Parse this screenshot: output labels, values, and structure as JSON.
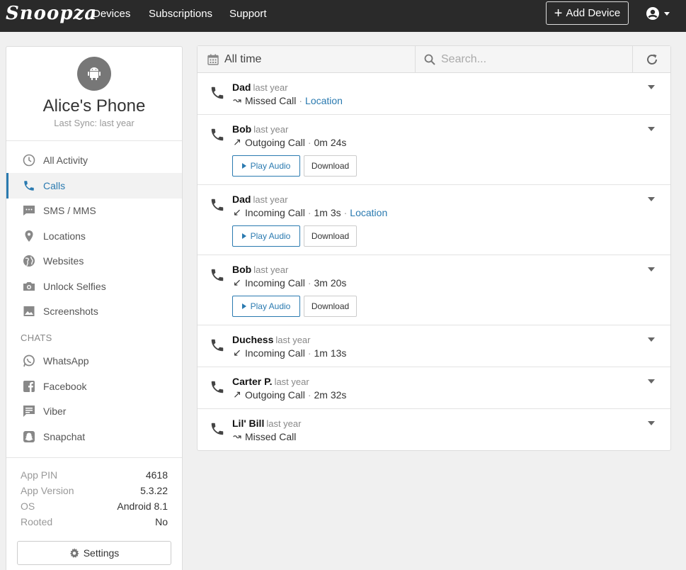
{
  "nav": {
    "logo": "Snoopza",
    "links": [
      "Devices",
      "Subscriptions",
      "Support"
    ],
    "add_device": "Add Device"
  },
  "device": {
    "name": "Alice's Phone",
    "last_sync": "Last Sync: last year"
  },
  "sidebar": {
    "items": [
      {
        "label": "All Activity",
        "icon": "clock-icon"
      },
      {
        "label": "Calls",
        "icon": "phone-icon",
        "active": true
      },
      {
        "label": "SMS / MMS",
        "icon": "sms-icon"
      },
      {
        "label": "Locations",
        "icon": "map-pin-icon"
      },
      {
        "label": "Websites",
        "icon": "globe-icon"
      },
      {
        "label": "Unlock Selfies",
        "icon": "camera-icon"
      },
      {
        "label": "Screenshots",
        "icon": "image-icon"
      }
    ],
    "chats_heading": "CHATS",
    "chat_items": [
      {
        "label": "WhatsApp",
        "icon": "whatsapp-icon"
      },
      {
        "label": "Facebook",
        "icon": "facebook-icon"
      },
      {
        "label": "Viber",
        "icon": "viber-icon"
      },
      {
        "label": "Snapchat",
        "icon": "snapchat-icon"
      }
    ],
    "info": [
      {
        "key": "App PIN",
        "value": "4618"
      },
      {
        "key": "App Version",
        "value": "5.3.22"
      },
      {
        "key": "OS",
        "value": "Android 8.1"
      },
      {
        "key": "Rooted",
        "value": "No"
      }
    ],
    "settings_label": "Settings"
  },
  "toolbar": {
    "date_range": "All time",
    "search_placeholder": "Search..."
  },
  "calls": [
    {
      "name": "Dad",
      "ago": "last year",
      "arrow": "↝",
      "type": "Missed Call",
      "duration": "",
      "location": "Location",
      "has_audio": false
    },
    {
      "name": "Bob",
      "ago": "last year",
      "arrow": "↗",
      "type": "Outgoing Call",
      "duration": "0m 24s",
      "location": "",
      "has_audio": true
    },
    {
      "name": "Dad",
      "ago": "last year",
      "arrow": "↙",
      "type": "Incoming Call",
      "duration": "1m 3s",
      "location": "Location",
      "has_audio": true
    },
    {
      "name": "Bob",
      "ago": "last year",
      "arrow": "↙",
      "type": "Incoming Call",
      "duration": "3m 20s",
      "location": "",
      "has_audio": true
    },
    {
      "name": "Duchess",
      "ago": "last year",
      "arrow": "↙",
      "type": "Incoming Call",
      "duration": "1m 13s",
      "location": "",
      "has_audio": false
    },
    {
      "name": "Carter P.",
      "ago": "last year",
      "arrow": "↗",
      "type": "Outgoing Call",
      "duration": "2m 32s",
      "location": "",
      "has_audio": false
    },
    {
      "name": "Lil' Bill",
      "ago": "last year",
      "arrow": "↝",
      "type": "Missed Call",
      "duration": "",
      "location": "",
      "has_audio": false
    }
  ],
  "buttons": {
    "play_audio": "Play Audio",
    "download": "Download"
  },
  "colors": {
    "accent": "#2a7ab0",
    "topbar": "#2a2a2a"
  }
}
